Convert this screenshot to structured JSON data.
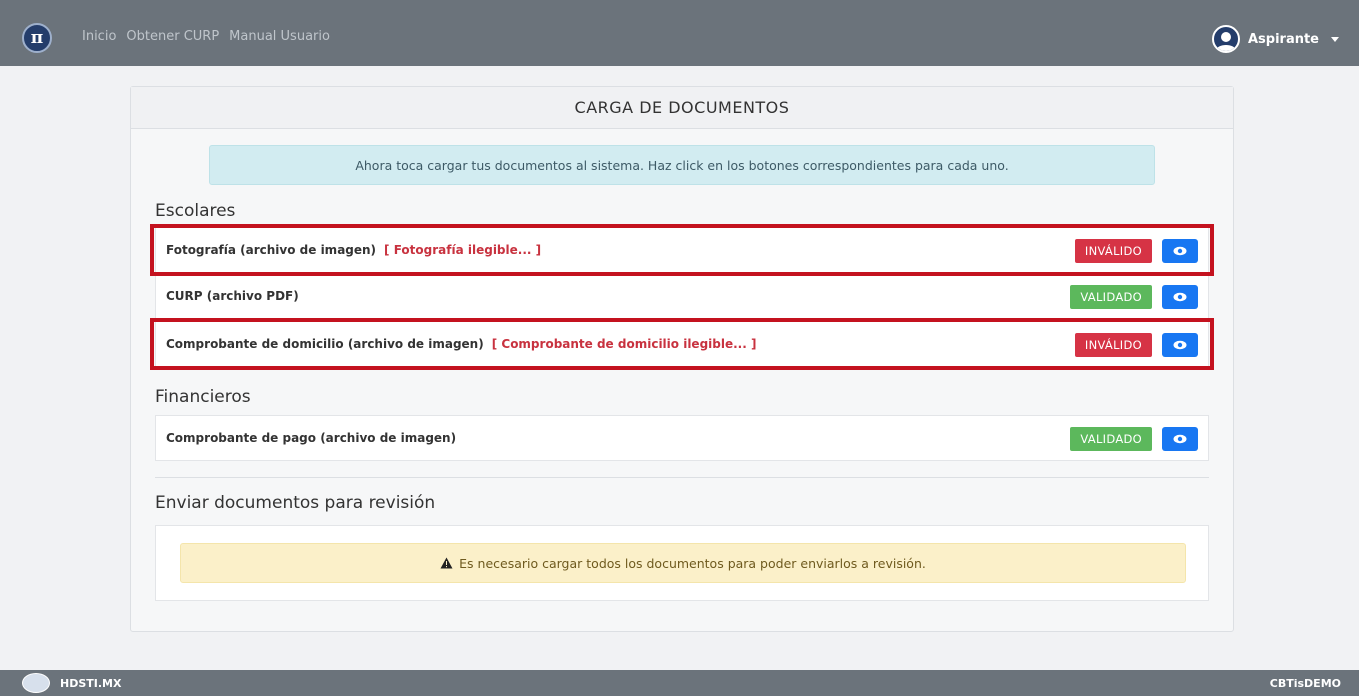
{
  "navbar": {
    "logo_glyph": "π",
    "links": [
      "Inicio",
      "Obtener CURP",
      "Manual Usuario"
    ],
    "user_label": "Aspirante"
  },
  "card": {
    "title": "CARGA DE DOCUMENTOS",
    "info_message": "Ahora toca cargar tus documentos al sistema. Haz click en los botones correspondientes para cada uno."
  },
  "sections": {
    "escolares": "Escolares",
    "financieros": "Financieros",
    "enviar": "Enviar documentos para revisión"
  },
  "documents": [
    {
      "label": "Fotografía (archivo de imagen)",
      "reason": "[ Fotografía ilegible... ]",
      "status": "INVÁLIDO",
      "status_color": "#d63345",
      "highlighted": true
    },
    {
      "label": "CURP (archivo PDF)",
      "reason": "",
      "status": "VALIDADO",
      "status_color": "#5cb85c",
      "highlighted": false
    },
    {
      "label": "Comprobante de domicilio (archivo de imagen)",
      "reason": "[ Comprobante de domicilio ilegible... ]",
      "status": "INVÁLIDO",
      "status_color": "#d63345",
      "highlighted": true
    },
    {
      "label": "Comprobante de pago (archivo de imagen)",
      "reason": "",
      "status": "VALIDADO",
      "status_color": "#5cb85c",
      "highlighted": false
    }
  ],
  "warning": {
    "icon": "warning-triangle-icon",
    "message": "Es necesario cargar todos los documentos para poder enviarlos a revisión."
  },
  "footer": {
    "left": "HDSTI.MX",
    "right": "CBTisDEMO"
  },
  "colors": {
    "navbar": "#6b737b",
    "invalid": "#d63345",
    "valid": "#5cb85c",
    "eye_button": "#1877f2",
    "highlight_frame": "#c4121f"
  }
}
